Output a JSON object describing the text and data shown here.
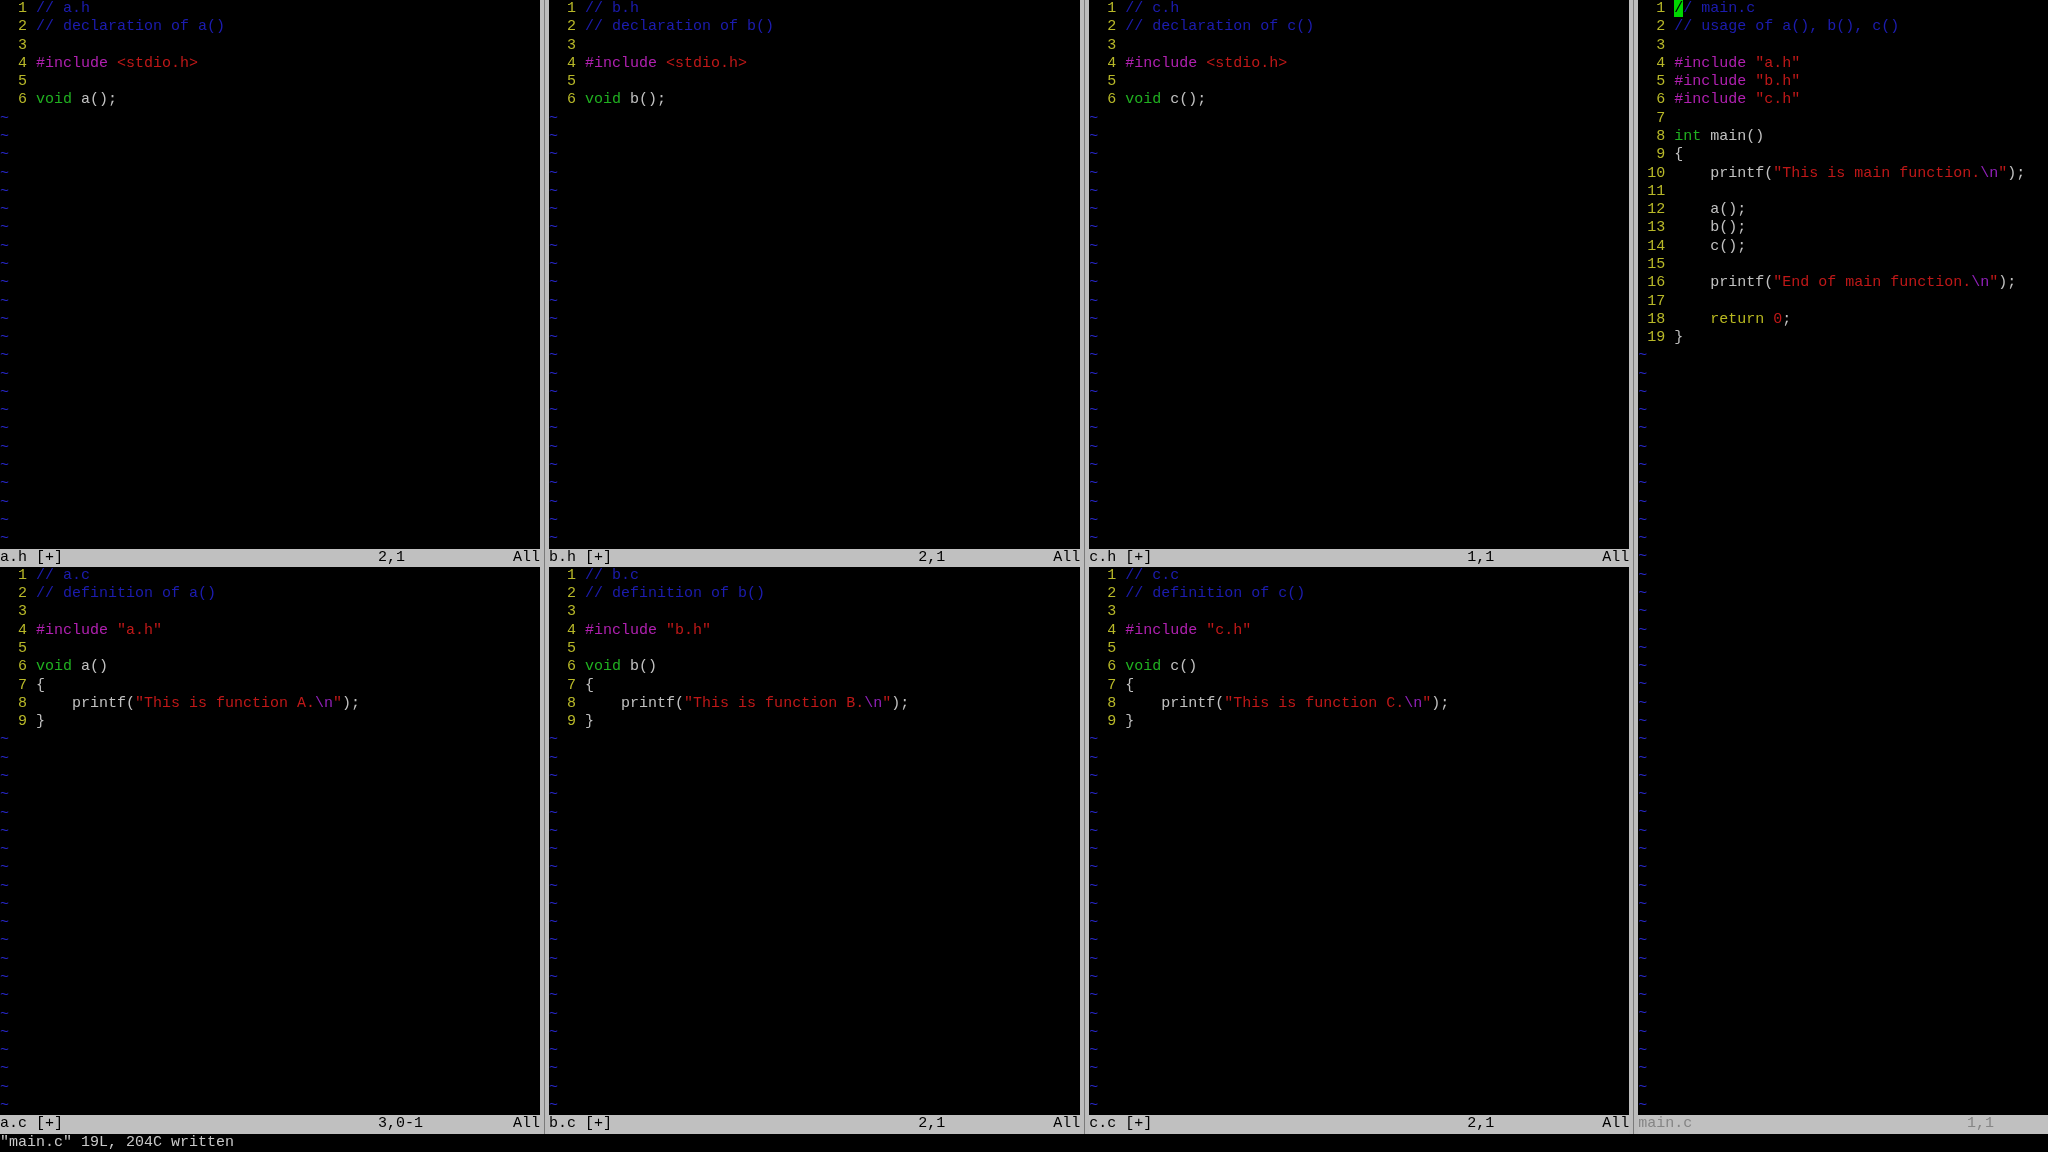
{
  "columns": [
    {
      "windows": [
        {
          "lines": [
            {
              "number": "1",
              "segments": [
                {
                  "kind": "comment",
                  "text": "// a.h"
                }
              ]
            },
            {
              "number": "2",
              "segments": [
                {
                  "kind": "comment",
                  "text": "// declaration of a()"
                }
              ]
            },
            {
              "number": "3"
            },
            {
              "number": "4",
              "segments": [
                {
                  "kind": "preproc",
                  "text": "#include "
                },
                {
                  "kind": "string",
                  "text": "<stdio.h>"
                }
              ]
            },
            {
              "number": "5"
            },
            {
              "number": "6",
              "segments": [
                {
                  "kind": "type",
                  "text": "void"
                },
                {
                  "kind": "normal",
                  "text": " a();"
                }
              ]
            }
          ],
          "filler": "~",
          "status": {
            "file": "a.h [+]",
            "ruler": "2,1",
            "scroll": "All",
            "current": false
          }
        },
        {
          "lines": [
            {
              "number": "1",
              "segments": [
                {
                  "kind": "comment",
                  "text": "// a.c"
                }
              ]
            },
            {
              "number": "2",
              "segments": [
                {
                  "kind": "comment",
                  "text": "// definition of a()"
                }
              ]
            },
            {
              "number": "3"
            },
            {
              "number": "4",
              "segments": [
                {
                  "kind": "preproc",
                  "text": "#include "
                },
                {
                  "kind": "string",
                  "text": "\"a.h\""
                }
              ]
            },
            {
              "number": "5"
            },
            {
              "number": "6",
              "segments": [
                {
                  "kind": "type",
                  "text": "void"
                },
                {
                  "kind": "normal",
                  "text": " a()"
                }
              ]
            },
            {
              "number": "7",
              "segments": [
                {
                  "kind": "normal",
                  "text": "{"
                }
              ]
            },
            {
              "number": "8",
              "segments": [
                {
                  "kind": "normal",
                  "text": "    printf("
                },
                {
                  "kind": "string",
                  "text": "\"This is function A."
                },
                {
                  "kind": "special",
                  "text": "\\n"
                },
                {
                  "kind": "string",
                  "text": "\""
                },
                {
                  "kind": "normal",
                  "text": ");"
                }
              ]
            },
            {
              "number": "9",
              "segments": [
                {
                  "kind": "normal",
                  "text": "}"
                }
              ]
            }
          ],
          "filler": "~",
          "status": {
            "file": "a.c [+]",
            "ruler": "3,0-1",
            "scroll": "All",
            "current": false
          }
        }
      ]
    },
    {
      "windows": [
        {
          "lines": [
            {
              "number": "1",
              "segments": [
                {
                  "kind": "comment",
                  "text": "// b.h"
                }
              ]
            },
            {
              "number": "2",
              "segments": [
                {
                  "kind": "comment",
                  "text": "// declaration of b()"
                }
              ]
            },
            {
              "number": "3"
            },
            {
              "number": "4",
              "segments": [
                {
                  "kind": "preproc",
                  "text": "#include "
                },
                {
                  "kind": "string",
                  "text": "<stdio.h>"
                }
              ]
            },
            {
              "number": "5"
            },
            {
              "number": "6",
              "segments": [
                {
                  "kind": "type",
                  "text": "void"
                },
                {
                  "kind": "normal",
                  "text": " b();"
                }
              ]
            }
          ],
          "filler": "~",
          "status": {
            "file": "b.h [+]",
            "ruler": "2,1",
            "scroll": "All",
            "current": false
          }
        },
        {
          "lines": [
            {
              "number": "1",
              "segments": [
                {
                  "kind": "comment",
                  "text": "// b.c"
                }
              ]
            },
            {
              "number": "2",
              "segments": [
                {
                  "kind": "comment",
                  "text": "// definition of b()"
                }
              ]
            },
            {
              "number": "3"
            },
            {
              "number": "4",
              "segments": [
                {
                  "kind": "preproc",
                  "text": "#include "
                },
                {
                  "kind": "string",
                  "text": "\"b.h\""
                }
              ]
            },
            {
              "number": "5"
            },
            {
              "number": "6",
              "segments": [
                {
                  "kind": "type",
                  "text": "void"
                },
                {
                  "kind": "normal",
                  "text": " b()"
                }
              ]
            },
            {
              "number": "7",
              "segments": [
                {
                  "kind": "normal",
                  "text": "{"
                }
              ]
            },
            {
              "number": "8",
              "segments": [
                {
                  "kind": "normal",
                  "text": "    printf("
                },
                {
                  "kind": "string",
                  "text": "\"This is function B."
                },
                {
                  "kind": "special",
                  "text": "\\n"
                },
                {
                  "kind": "string",
                  "text": "\""
                },
                {
                  "kind": "normal",
                  "text": ");"
                }
              ]
            },
            {
              "number": "9",
              "segments": [
                {
                  "kind": "normal",
                  "text": "}"
                }
              ]
            }
          ],
          "filler": "~",
          "status": {
            "file": "b.c [+]",
            "ruler": "2,1",
            "scroll": "All",
            "current": false
          }
        }
      ]
    },
    {
      "windows": [
        {
          "lines": [
            {
              "number": "1",
              "segments": [
                {
                  "kind": "comment",
                  "text": "// c.h"
                }
              ]
            },
            {
              "number": "2",
              "segments": [
                {
                  "kind": "comment",
                  "text": "// declaration of c()"
                }
              ]
            },
            {
              "number": "3"
            },
            {
              "number": "4",
              "segments": [
                {
                  "kind": "preproc",
                  "text": "#include "
                },
                {
                  "kind": "string",
                  "text": "<stdio.h>"
                }
              ]
            },
            {
              "number": "5"
            },
            {
              "number": "6",
              "segments": [
                {
                  "kind": "type",
                  "text": "void"
                },
                {
                  "kind": "normal",
                  "text": " c();"
                }
              ]
            }
          ],
          "filler": "~",
          "status": {
            "file": "c.h [+]",
            "ruler": "1,1",
            "scroll": "All",
            "current": false
          }
        },
        {
          "lines": [
            {
              "number": "1",
              "segments": [
                {
                  "kind": "comment",
                  "text": "// c.c"
                }
              ]
            },
            {
              "number": "2",
              "segments": [
                {
                  "kind": "comment",
                  "text": "// definition of c()"
                }
              ]
            },
            {
              "number": "3"
            },
            {
              "number": "4",
              "segments": [
                {
                  "kind": "preproc",
                  "text": "#include "
                },
                {
                  "kind": "string",
                  "text": "\"c.h\""
                }
              ]
            },
            {
              "number": "5"
            },
            {
              "number": "6",
              "segments": [
                {
                  "kind": "type",
                  "text": "void"
                },
                {
                  "kind": "normal",
                  "text": " c()"
                }
              ]
            },
            {
              "number": "7",
              "segments": [
                {
                  "kind": "normal",
                  "text": "{"
                }
              ]
            },
            {
              "number": "8",
              "segments": [
                {
                  "kind": "normal",
                  "text": "    printf("
                },
                {
                  "kind": "string",
                  "text": "\"This is function C."
                },
                {
                  "kind": "special",
                  "text": "\\n"
                },
                {
                  "kind": "string",
                  "text": "\""
                },
                {
                  "kind": "normal",
                  "text": ");"
                }
              ]
            },
            {
              "number": "9",
              "segments": [
                {
                  "kind": "normal",
                  "text": "}"
                }
              ]
            }
          ],
          "filler": "~",
          "status": {
            "file": "c.c [+]",
            "ruler": "2,1",
            "scroll": "All",
            "current": false
          }
        }
      ]
    },
    {
      "windows": [
        {
          "lines": [
            {
              "number": "1",
              "segments": [
                {
                  "kind": "cursor",
                  "text": "/"
                },
                {
                  "kind": "comment",
                  "text": "/ main.c"
                }
              ]
            },
            {
              "number": "2",
              "segments": [
                {
                  "kind": "comment",
                  "text": "// usage of a(), b(), c()"
                }
              ]
            },
            {
              "number": "3"
            },
            {
              "number": "4",
              "segments": [
                {
                  "kind": "preproc",
                  "text": "#include "
                },
                {
                  "kind": "string",
                  "text": "\"a.h\""
                }
              ]
            },
            {
              "number": "5",
              "segments": [
                {
                  "kind": "preproc",
                  "text": "#include "
                },
                {
                  "kind": "string",
                  "text": "\"b.h\""
                }
              ]
            },
            {
              "number": "6",
              "segments": [
                {
                  "kind": "preproc",
                  "text": "#include "
                },
                {
                  "kind": "string",
                  "text": "\"c.h\""
                }
              ]
            },
            {
              "number": "7"
            },
            {
              "number": "8",
              "segments": [
                {
                  "kind": "type",
                  "text": "int"
                },
                {
                  "kind": "normal",
                  "text": " main()"
                }
              ]
            },
            {
              "number": "9",
              "segments": [
                {
                  "kind": "normal",
                  "text": "{"
                }
              ]
            },
            {
              "number": "10",
              "segments": [
                {
                  "kind": "normal",
                  "text": "    printf("
                },
                {
                  "kind": "string",
                  "text": "\"This is main function."
                },
                {
                  "kind": "special",
                  "text": "\\n"
                },
                {
                  "kind": "string",
                  "text": "\""
                },
                {
                  "kind": "normal",
                  "text": ");"
                }
              ]
            },
            {
              "number": "11"
            },
            {
              "number": "12",
              "segments": [
                {
                  "kind": "normal",
                  "text": "    a();"
                }
              ]
            },
            {
              "number": "13",
              "segments": [
                {
                  "kind": "normal",
                  "text": "    b();"
                }
              ]
            },
            {
              "number": "14",
              "segments": [
                {
                  "kind": "normal",
                  "text": "    c();"
                }
              ]
            },
            {
              "number": "15"
            },
            {
              "number": "16",
              "segments": [
                {
                  "kind": "normal",
                  "text": "    printf("
                },
                {
                  "kind": "string",
                  "text": "\"End of main function."
                },
                {
                  "kind": "special",
                  "text": "\\n"
                },
                {
                  "kind": "string",
                  "text": "\""
                },
                {
                  "kind": "normal",
                  "text": ");"
                }
              ]
            },
            {
              "number": "17"
            },
            {
              "number": "18",
              "segments": [
                {
                  "kind": "statement",
                  "text": "    return "
                },
                {
                  "kind": "number",
                  "text": "0"
                },
                {
                  "kind": "normal",
                  "text": ";"
                }
              ]
            },
            {
              "number": "19",
              "segments": [
                {
                  "kind": "normal",
                  "text": "}"
                }
              ]
            }
          ],
          "filler": "~",
          "status": {
            "file": "main.c",
            "ruler": "1,1",
            "current": true
          }
        }
      ]
    }
  ],
  "command_line": "\"main.c\" 19L, 204C written"
}
